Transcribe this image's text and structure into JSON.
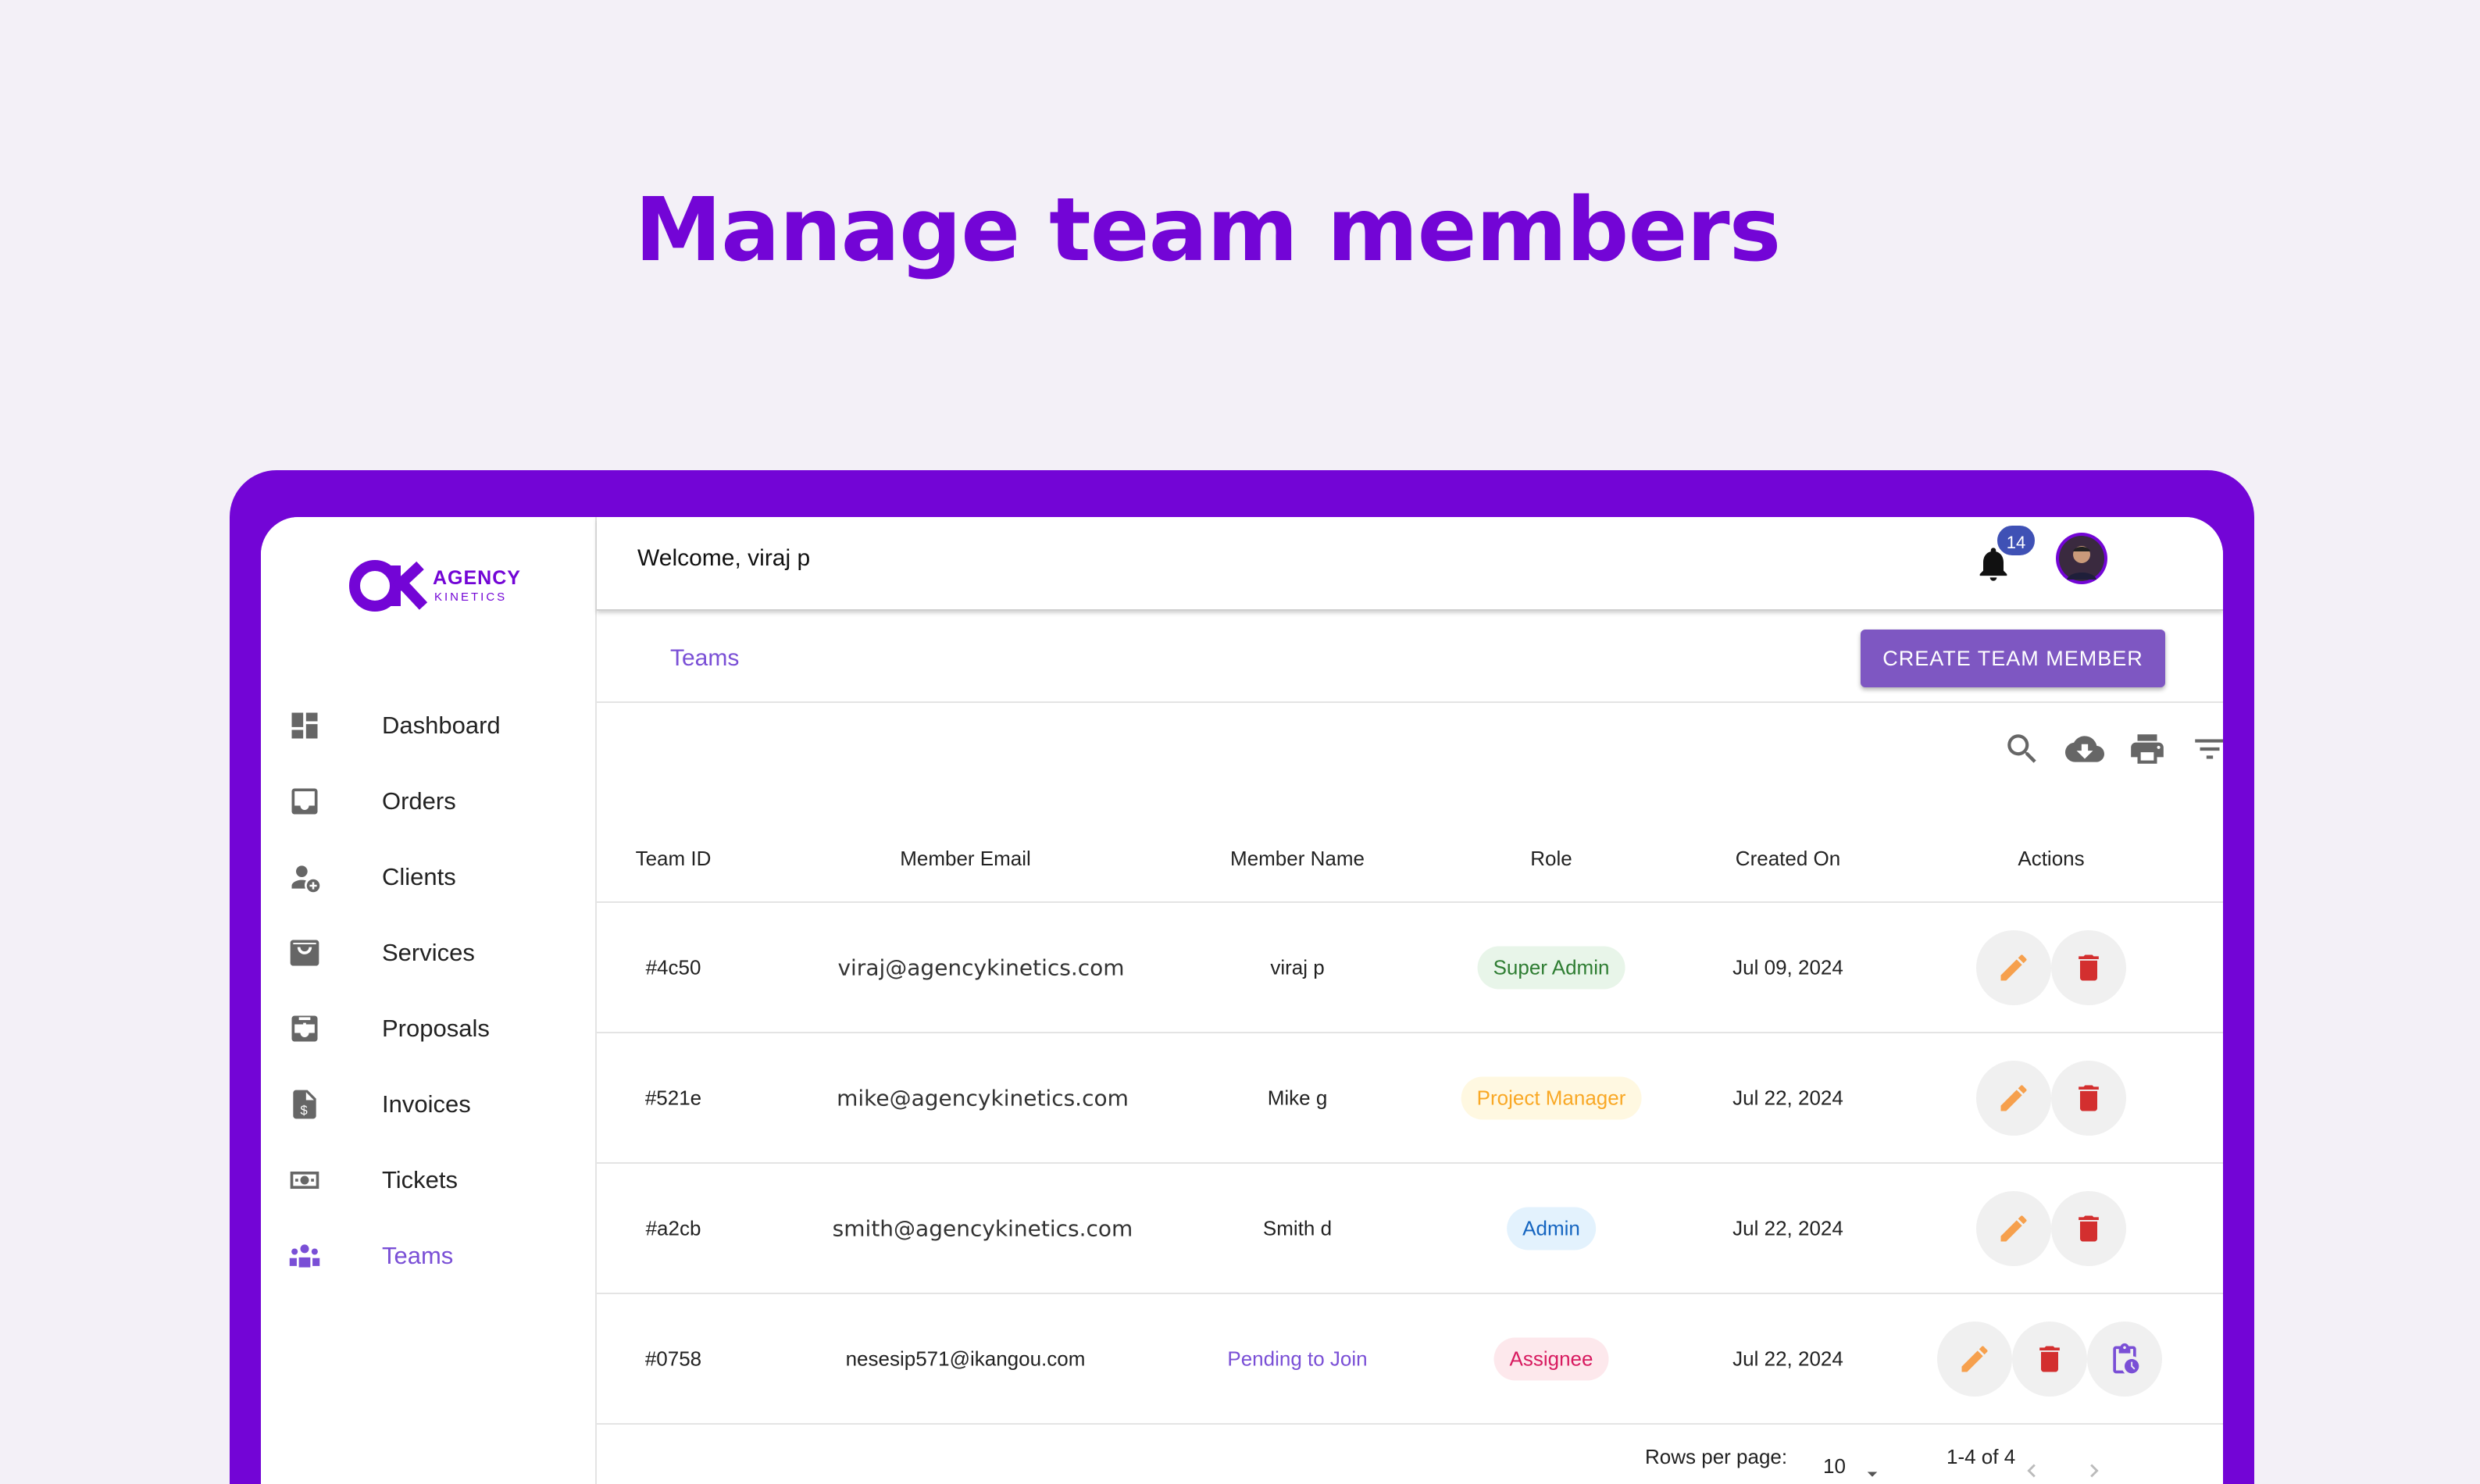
{
  "headline": "Manage team members",
  "brand": {
    "name_line1": "AGENCY",
    "name_line2": "KINETICS"
  },
  "sidebar": {
    "items": [
      {
        "label": "Dashboard",
        "icon": "dashboard-icon"
      },
      {
        "label": "Orders",
        "icon": "inbox-icon"
      },
      {
        "label": "Clients",
        "icon": "person-add-icon"
      },
      {
        "label": "Services",
        "icon": "shopping-bag-icon"
      },
      {
        "label": "Proposals",
        "icon": "move-to-inbox-icon"
      },
      {
        "label": "Invoices",
        "icon": "invoice-dollar-icon"
      },
      {
        "label": "Tickets",
        "icon": "money-ticket-icon"
      },
      {
        "label": "Teams",
        "icon": "groups-icon",
        "active": true
      }
    ]
  },
  "header": {
    "welcome": "Welcome, viraj p",
    "notification_count": "14"
  },
  "subbar": {
    "tab": "Teams",
    "create_button": "CREATE TEAM MEMBER"
  },
  "table": {
    "columns": [
      "Team ID",
      "Member Email",
      "Member Name",
      "Role",
      "Created On",
      "Actions"
    ],
    "rows": [
      {
        "id": "#4c50",
        "email": "viraj@agencykinetics.com",
        "name": "viraj p",
        "role": "Super Admin",
        "created": "Jul 09, 2024"
      },
      {
        "id": "#521e",
        "email": "mike@agencykinetics.com",
        "name": "Mike g",
        "role": "Project Manager",
        "created": "Jul 22, 2024"
      },
      {
        "id": "#a2cb",
        "email": "smith@agencykinetics.com",
        "name": "Smith d",
        "role": "Admin",
        "created": "Jul 22, 2024"
      },
      {
        "id": "#0758",
        "email": "nesesip571@ikangou.com",
        "name": "Pending to Join",
        "role": "Assignee",
        "created": "Jul 22, 2024"
      }
    ]
  },
  "pagination": {
    "rows_per_page_label": "Rows per page:",
    "rows_per_page": "10",
    "range": "1-4 of 4"
  },
  "colors": {
    "brand": "#7305d6",
    "accent": "#7e57c2",
    "super_admin_bg": "#e8f5e9",
    "super_admin_fg": "#2e7d32",
    "project_manager_bg": "#fff8e1",
    "project_manager_fg": "#f9a825",
    "admin_bg": "#e3f2fd",
    "admin_fg": "#1565c0",
    "assignee_bg": "#fde8ec",
    "assignee_fg": "#d81b60"
  }
}
